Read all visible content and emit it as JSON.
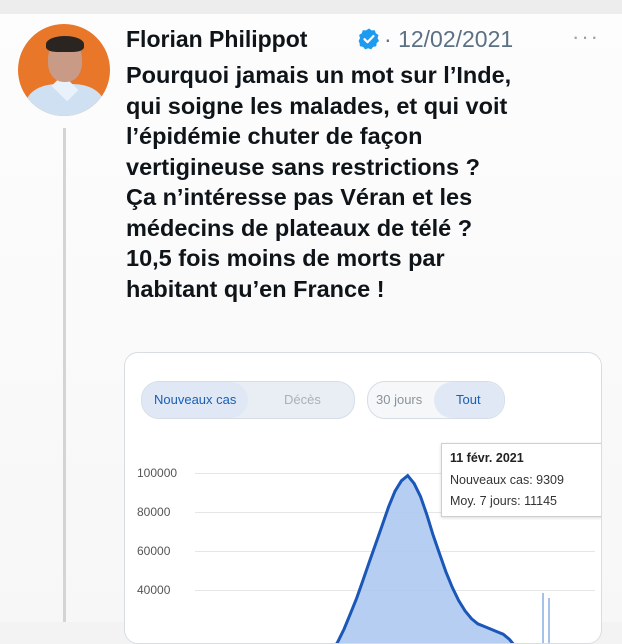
{
  "tweet": {
    "author_name": "Florian Philippot",
    "date": "12/02/2021",
    "more_label": "···",
    "text_before": "Pourquoi jamais un mot sur l’",
    "text_bold": "Inde",
    "text_after": ",\nqui soigne les malades, et qui voit\nl’épidémie chuter de façon\nvertigineuse sans restrictions ?\nÇa n’intéresse pas Véran et les\nmédecins de plateaux de télé ?\n10,5 fois moins de morts par\nhabitant qu’en France !"
  },
  "card": {
    "metric_tabs": [
      "Nouveaux cas",
      "Décès"
    ],
    "range_tabs": [
      "30 jours",
      "Tout"
    ],
    "tooltip": {
      "date": "11 févr. 2021",
      "new_cases": "Nouveaux cas: 9309",
      "avg7": "Moy. 7 jours: 11145"
    }
  },
  "chart_data": {
    "type": "area",
    "y_ticks": [
      "100000",
      "80000",
      "60000",
      "40000"
    ],
    "ylim": [
      20000,
      110000
    ],
    "series": [
      {
        "values": [
          22000,
          26000,
          30000,
          35000,
          41000,
          47000,
          54000,
          61000,
          68000,
          75000,
          82000,
          88000,
          92000,
          94000,
          91000,
          86000,
          79000,
          71000,
          64000,
          57000,
          51000,
          46000,
          42000,
          39000,
          37000,
          36000,
          35000,
          34000,
          33000,
          31000,
          28000,
          25000,
          22000,
          20000
        ]
      }
    ],
    "colors": {
      "line": "#1a57b8",
      "fill": "#a9c5ee"
    }
  }
}
